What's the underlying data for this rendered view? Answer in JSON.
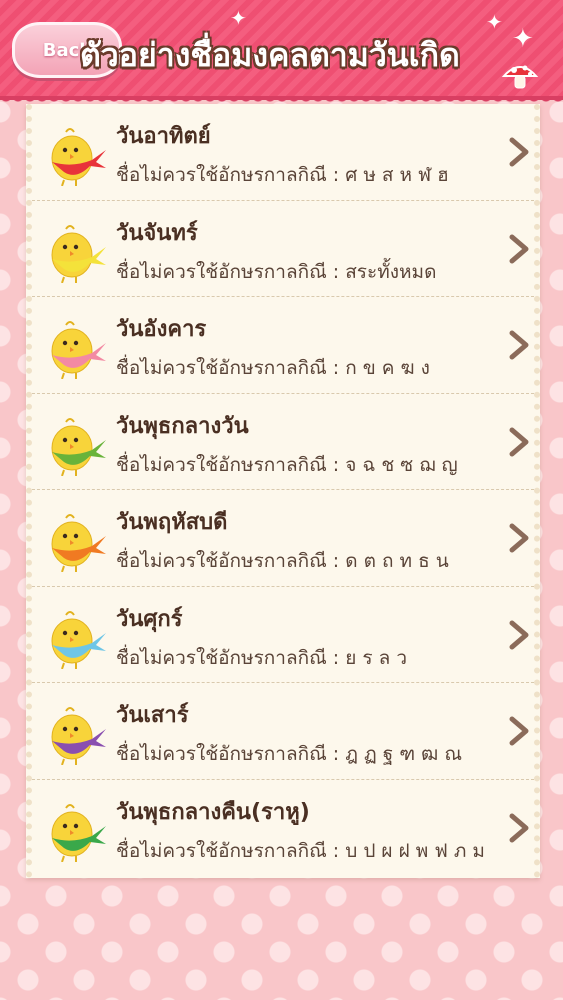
{
  "header": {
    "back_label": "Back",
    "title": "ตัวอย่างชื่อมงคลตามวันเกิด"
  },
  "colors": {
    "header_pink": "#f45e7f",
    "card_bg": "#fdf8ec",
    "text_brown": "#4a2f22",
    "chevron_brown": "#8b6b5a"
  },
  "days": [
    {
      "title": "วันอาทิตย์",
      "subtitle": "ชื่อไม่ควรใช้อักษรกาลกิณี : ศ ษ ส ห ฬ ฮ",
      "scarf_color": "#e8333a"
    },
    {
      "title": "วันจันทร์",
      "subtitle": "ชื่อไม่ควรใช้อักษรกาลกิณี : สระทั้งหมด",
      "scarf_color": "#f4e23a"
    },
    {
      "title": "วันอังคาร",
      "subtitle": "ชื่อไม่ควรใช้อักษรกาลกิณี : ก ข ค ฆ ง",
      "scarf_color": "#f38aa3"
    },
    {
      "title": "วันพุธกลางวัน",
      "subtitle": "ชื่อไม่ควรใช้อักษรกาลกิณี : จ ฉ ช ซ ฌ ญ",
      "scarf_color": "#69b33a"
    },
    {
      "title": "วันพฤหัสบดี",
      "subtitle": "ชื่อไม่ควรใช้อักษรกาลกิณี : ด ต ถ ท ธ น",
      "scarf_color": "#f07a22"
    },
    {
      "title": "วันศุกร์",
      "subtitle": "ชื่อไม่ควรใช้อักษรกาลกิณี : ย ร ล ว",
      "scarf_color": "#6fc6e6"
    },
    {
      "title": "วันเสาร์",
      "subtitle": "ชื่อไม่ควรใช้อักษรกาลกิณี : ฎ ฏ ฐ ฑ ฒ ณ",
      "scarf_color": "#8a4fb0"
    },
    {
      "title": "วันพุธกลางคืน(ราหู)",
      "subtitle": "ชื่อไม่ควรใช้อักษรกาลกิณี : บ ป ผ ฝ พ ฟ ภ ม",
      "scarf_color": "#3aa84a"
    }
  ]
}
